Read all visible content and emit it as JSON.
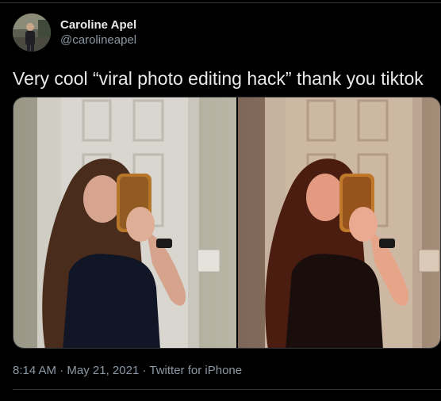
{
  "author": {
    "display_name": "Caroline Apel",
    "handle": "@carolineapel",
    "avatar_icon": "profile-photo"
  },
  "tweet": {
    "text": "Very cool “viral photo editing hack” thank you tiktok"
  },
  "media": {
    "photos": [
      {
        "label": "original-photo"
      },
      {
        "label": "edited-photo"
      }
    ]
  },
  "meta": {
    "time": "8:14 AM",
    "separator": "·",
    "date": "May 21, 2021",
    "source": "Twitter for iPhone"
  },
  "colors": {
    "background": "#000000",
    "text_primary": "#e7e9ea",
    "text_secondary": "#8b98a5",
    "divider": "#2f3336"
  }
}
